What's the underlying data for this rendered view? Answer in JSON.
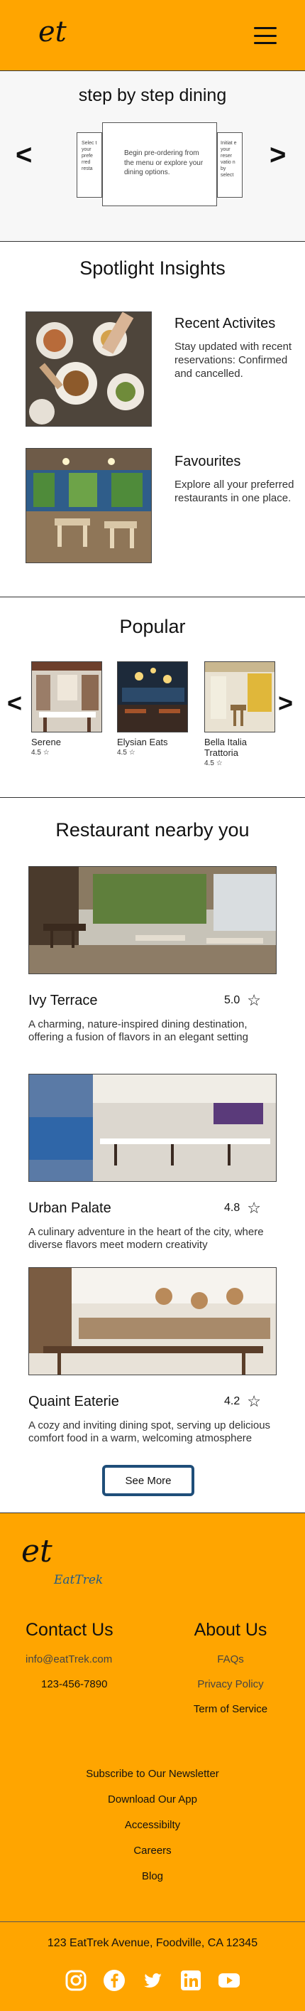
{
  "header": {
    "logo": "et"
  },
  "steps": {
    "title": "step by step dining",
    "prev": "<",
    "next": ">",
    "left_card": "Selec t your prefe rred resta",
    "main_card": "Begin pre-ordering from the menu or explore your dining options.",
    "right_card": "Initiat e your reser vatio n by select"
  },
  "spotlight": {
    "title": "Spotlight Insights",
    "items": [
      {
        "title": "Recent Activites",
        "text": "Stay updated with recent reservations: Confirmed and cancelled."
      },
      {
        "title": "Favourites",
        "text": "Explore all your preferred restaurants in one place."
      }
    ]
  },
  "popular": {
    "title": "Popular",
    "prev": "<",
    "next": ">",
    "items": [
      {
        "name": "Serene",
        "rating": "4.5"
      },
      {
        "name": "Elysian Eats",
        "rating": "4.5"
      },
      {
        "name": "Bella Italia Trattoria",
        "rating": "4.5"
      }
    ]
  },
  "nearby": {
    "title": "Restaurant nearby you",
    "items": [
      {
        "name": "Ivy Terrace",
        "rating": "5.0",
        "desc": "A charming, nature-inspired dining destination, offering a fusion of flavors in an elegant setting"
      },
      {
        "name": "Urban Palate",
        "rating": "4.8",
        "desc": "A culinary adventure in the heart of the city, where diverse flavors meet modern creativity"
      },
      {
        "name": "Quaint Eaterie",
        "rating": "4.2",
        "desc": "A cozy and inviting dining spot, serving up delicious comfort food in a warm, welcoming atmosphere"
      }
    ],
    "see_more": "See More"
  },
  "footer": {
    "logo": "et",
    "logo_sub": "EatTrek",
    "contact_title": "Contact Us",
    "email": "info@eatTrek.com",
    "phone": "123-456-7890",
    "about_title": "About Us",
    "about_links": [
      "FAQs",
      "Privacy Policy",
      "Term of Service"
    ],
    "links": [
      "Subscribe to Our Newsletter",
      "Download Our App",
      "Accessibilty",
      "Careers",
      "Blog"
    ],
    "address": "123 EatTrek Avenue, Foodville, CA 12345",
    "social_icons": [
      "instagram-icon",
      "facebook-icon",
      "twitter-icon",
      "linkedin-icon",
      "youtube-icon"
    ]
  },
  "colors": {
    "brand": "#ffa500",
    "button_border": "#1f4e79",
    "logo_sub": "#1f5a8a"
  }
}
